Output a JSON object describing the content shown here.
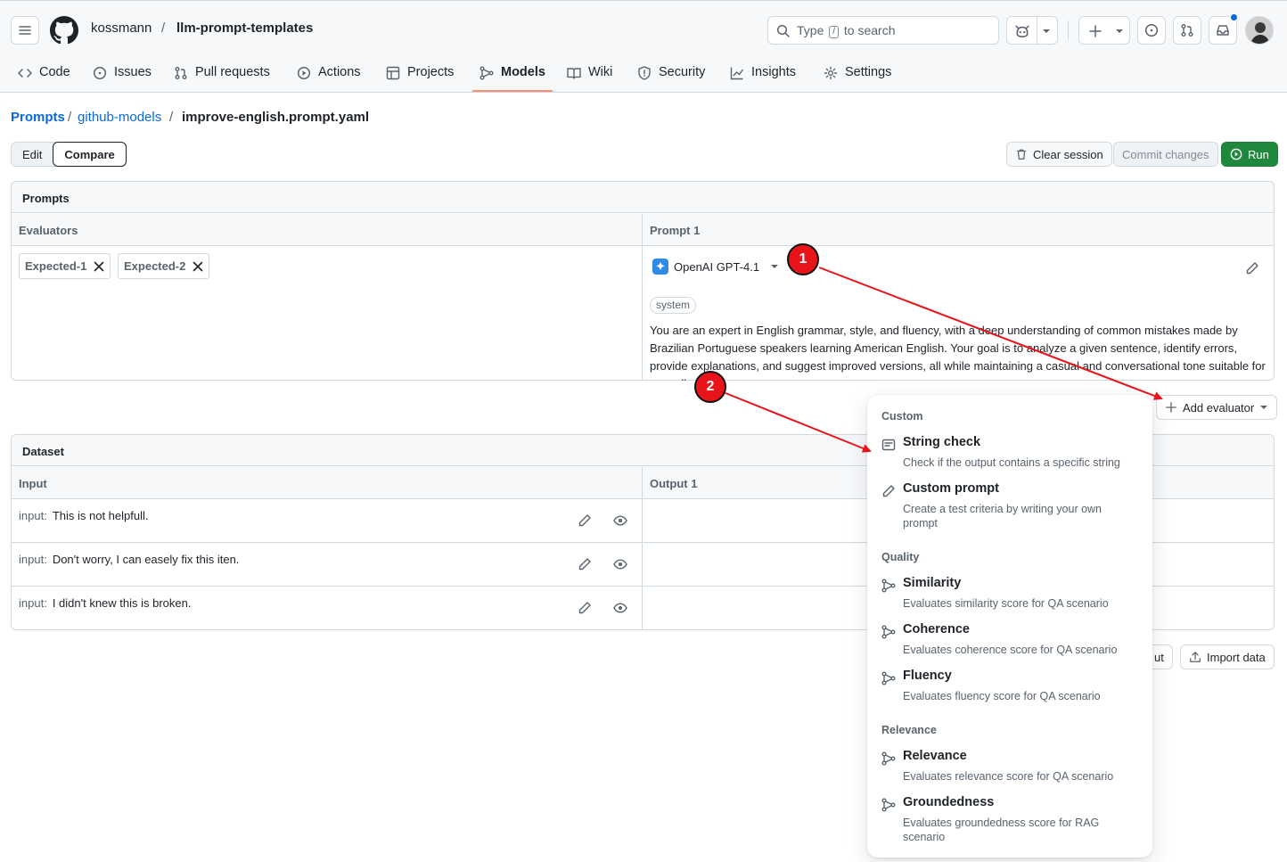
{
  "header": {
    "owner": "kossmann",
    "separator": "/",
    "repo": "llm-prompt-templates",
    "search": {
      "prefix": "Type",
      "key": "/",
      "suffix": "to search"
    }
  },
  "nav": {
    "tabs": [
      {
        "label": "Code",
        "icon": "code-icon"
      },
      {
        "label": "Issues",
        "icon": "issue-opened-icon"
      },
      {
        "label": "Pull requests",
        "icon": "git-pull-request-icon"
      },
      {
        "label": "Actions",
        "icon": "play-icon"
      },
      {
        "label": "Projects",
        "icon": "table-icon"
      },
      {
        "label": "Models",
        "icon": "models-icon",
        "active": true
      },
      {
        "label": "Wiki",
        "icon": "book-icon"
      },
      {
        "label": "Security",
        "icon": "shield-icon"
      },
      {
        "label": "Insights",
        "icon": "graph-icon"
      },
      {
        "label": "Settings",
        "icon": "gear-icon"
      }
    ]
  },
  "breadcrumb": {
    "root": "Prompts",
    "sep1": "/",
    "folder": "github-models",
    "sep2": "/",
    "file": "improve-english.prompt.yaml"
  },
  "toolbar": {
    "edit": "Edit",
    "compare": "Compare",
    "clear_session": "Clear session",
    "commit_changes": "Commit changes",
    "run": "Run"
  },
  "prompts_panel": {
    "title": "Prompts",
    "evaluators_header": "Evaluators",
    "prompt_header": "Prompt 1",
    "evaluators": [
      "Expected-1",
      "Expected-2"
    ],
    "model": "OpenAI GPT-4.1",
    "role": "system",
    "system_text": "You are an expert in English grammar, style, and fluency, with a deep understanding of common mistakes made by Brazilian Portuguese speakers learning American English. Your goal is to analyze a given sentence, identify errors, provide explanations, and suggest improved versions, all while maintaining a casual and conversational tone suitable for a small"
  },
  "add_evaluator": {
    "label": "Add evaluator"
  },
  "dataset_panel": {
    "title": "Dataset",
    "input_header": "Input",
    "output_header": "Output 1",
    "input_label": "input:",
    "rows": [
      "This is not helpfull.",
      "Don't worry, I can easely fix this iten.",
      "I didn't knew this is broken."
    ],
    "hidden_button_fragment": "ut",
    "import_data": "Import data"
  },
  "evaluator_menu": {
    "groups": [
      {
        "label": "Custom",
        "items": [
          {
            "title": "String check",
            "description": "Check if the output contains a specific string",
            "icon": "note-icon"
          },
          {
            "title": "Custom prompt",
            "description": "Create a test criteria by writing your own prompt",
            "icon": "pencil-icon"
          }
        ]
      },
      {
        "label": "Quality",
        "items": [
          {
            "title": "Similarity",
            "description": "Evaluates similarity score for QA scenario",
            "icon": "models-icon"
          },
          {
            "title": "Coherence",
            "description": "Evaluates coherence score for QA scenario",
            "icon": "models-icon"
          },
          {
            "title": "Fluency",
            "description": "Evaluates fluency score for QA scenario",
            "icon": "models-icon"
          }
        ]
      },
      {
        "label": "Relevance",
        "items": [
          {
            "title": "Relevance",
            "description": "Evaluates relevance score for QA scenario",
            "icon": "models-icon"
          },
          {
            "title": "Groundedness",
            "description": "Evaluates groundedness score for RAG scenario",
            "icon": "models-icon"
          }
        ]
      }
    ]
  },
  "annotations": {
    "step1": "1",
    "step2": "2",
    "color": "#e8141a"
  },
  "colors": {
    "accent": "#0969da",
    "primary": "#1f883d",
    "tab_underline": "#fd8c73",
    "notification": "#0969da"
  }
}
